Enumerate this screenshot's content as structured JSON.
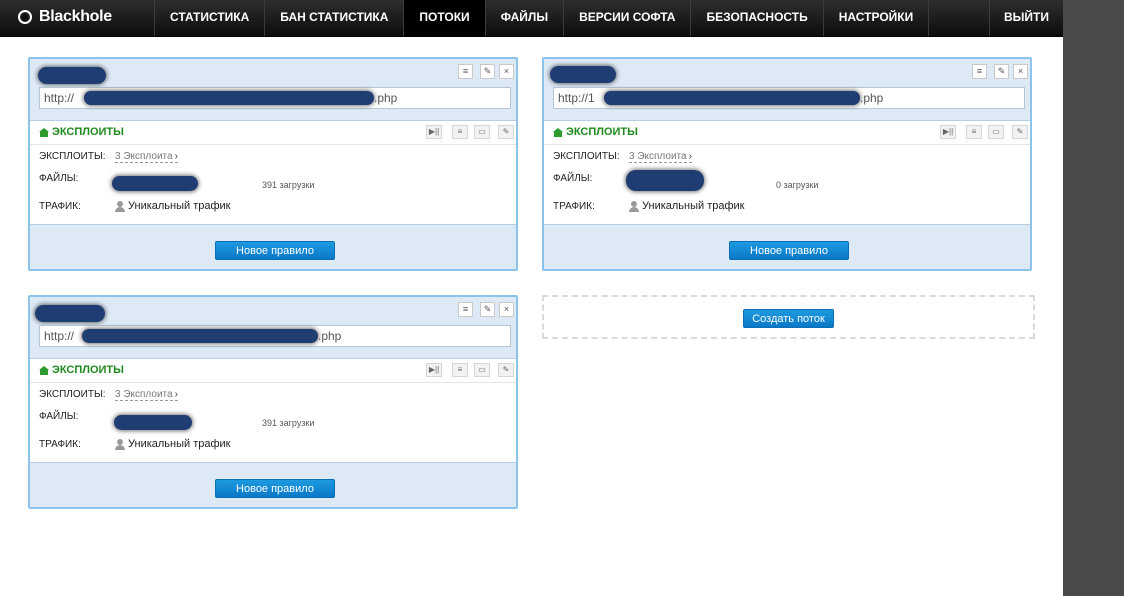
{
  "brand": {
    "name": "Blackhole"
  },
  "nav": {
    "items": [
      {
        "label": "СТАТИСТИКА"
      },
      {
        "label": "БАН СТАТИСТИКА"
      },
      {
        "label": "ПОТОКИ"
      },
      {
        "label": "ФАЙЛЫ"
      },
      {
        "label": "ВЕРСИИ СОФТА"
      },
      {
        "label": "БЕЗОПАСНОСТЬ"
      },
      {
        "label": "НАСТРОЙКИ"
      }
    ],
    "active": "ПОТОКИ",
    "logout_label": "ВЫЙТИ"
  },
  "streams": [
    {
      "url_prefix": "http://",
      "url_suffix": ".php",
      "exploits_title": "ЭКСПЛОИТЫ",
      "exploits_label": "ЭКСПЛОИТЫ:",
      "exploits_link": "3 Эксплоита",
      "files_label": "ФАЙЛЫ:",
      "downloads": "391 загрузки",
      "traffic_label": "ТРАФИК:",
      "traffic_value": "Уникальный трафик",
      "rule_button": "Новое правило"
    },
    {
      "url_prefix": "http://1",
      "url_suffix": ".php",
      "exploits_title": "ЭКСПЛОИТЫ",
      "exploits_label": "ЭКСПЛОИТЫ:",
      "exploits_link": "3 Эксплоита",
      "files_label": "ФАЙЛЫ:",
      "downloads": "0 загрузки",
      "traffic_label": "ТРАФИК:",
      "traffic_value": "Уникальный трафик",
      "rule_button": "Новое правило"
    },
    {
      "url_prefix": "http://",
      "url_suffix": ".php",
      "exploits_title": "ЭКСПЛОИТЫ",
      "exploits_label": "ЭКСПЛОИТЫ:",
      "exploits_link": "3 Эксплоита",
      "files_label": "ФАЙЛЫ:",
      "downloads": "391 загрузки",
      "traffic_label": "ТРАФИК:",
      "traffic_value": "Уникальный трафик",
      "rule_button": "Новое правило"
    }
  ],
  "create_stream_button": "Создать поток",
  "colors": {
    "accent": "#0b78c7",
    "exploits_green": "#1e8a1e",
    "panel_border": "#8cc3ea",
    "panel_bg": "#ddeaf6"
  },
  "icons": {
    "stream_controls": [
      "list-icon",
      "wrench-icon",
      "close-icon"
    ],
    "exploit_controls": [
      "play-pause-icon",
      "list-icon",
      "window-icon",
      "wrench-icon"
    ],
    "exploits_title_icon": "house-icon",
    "traffic_icon": "user-icon"
  }
}
